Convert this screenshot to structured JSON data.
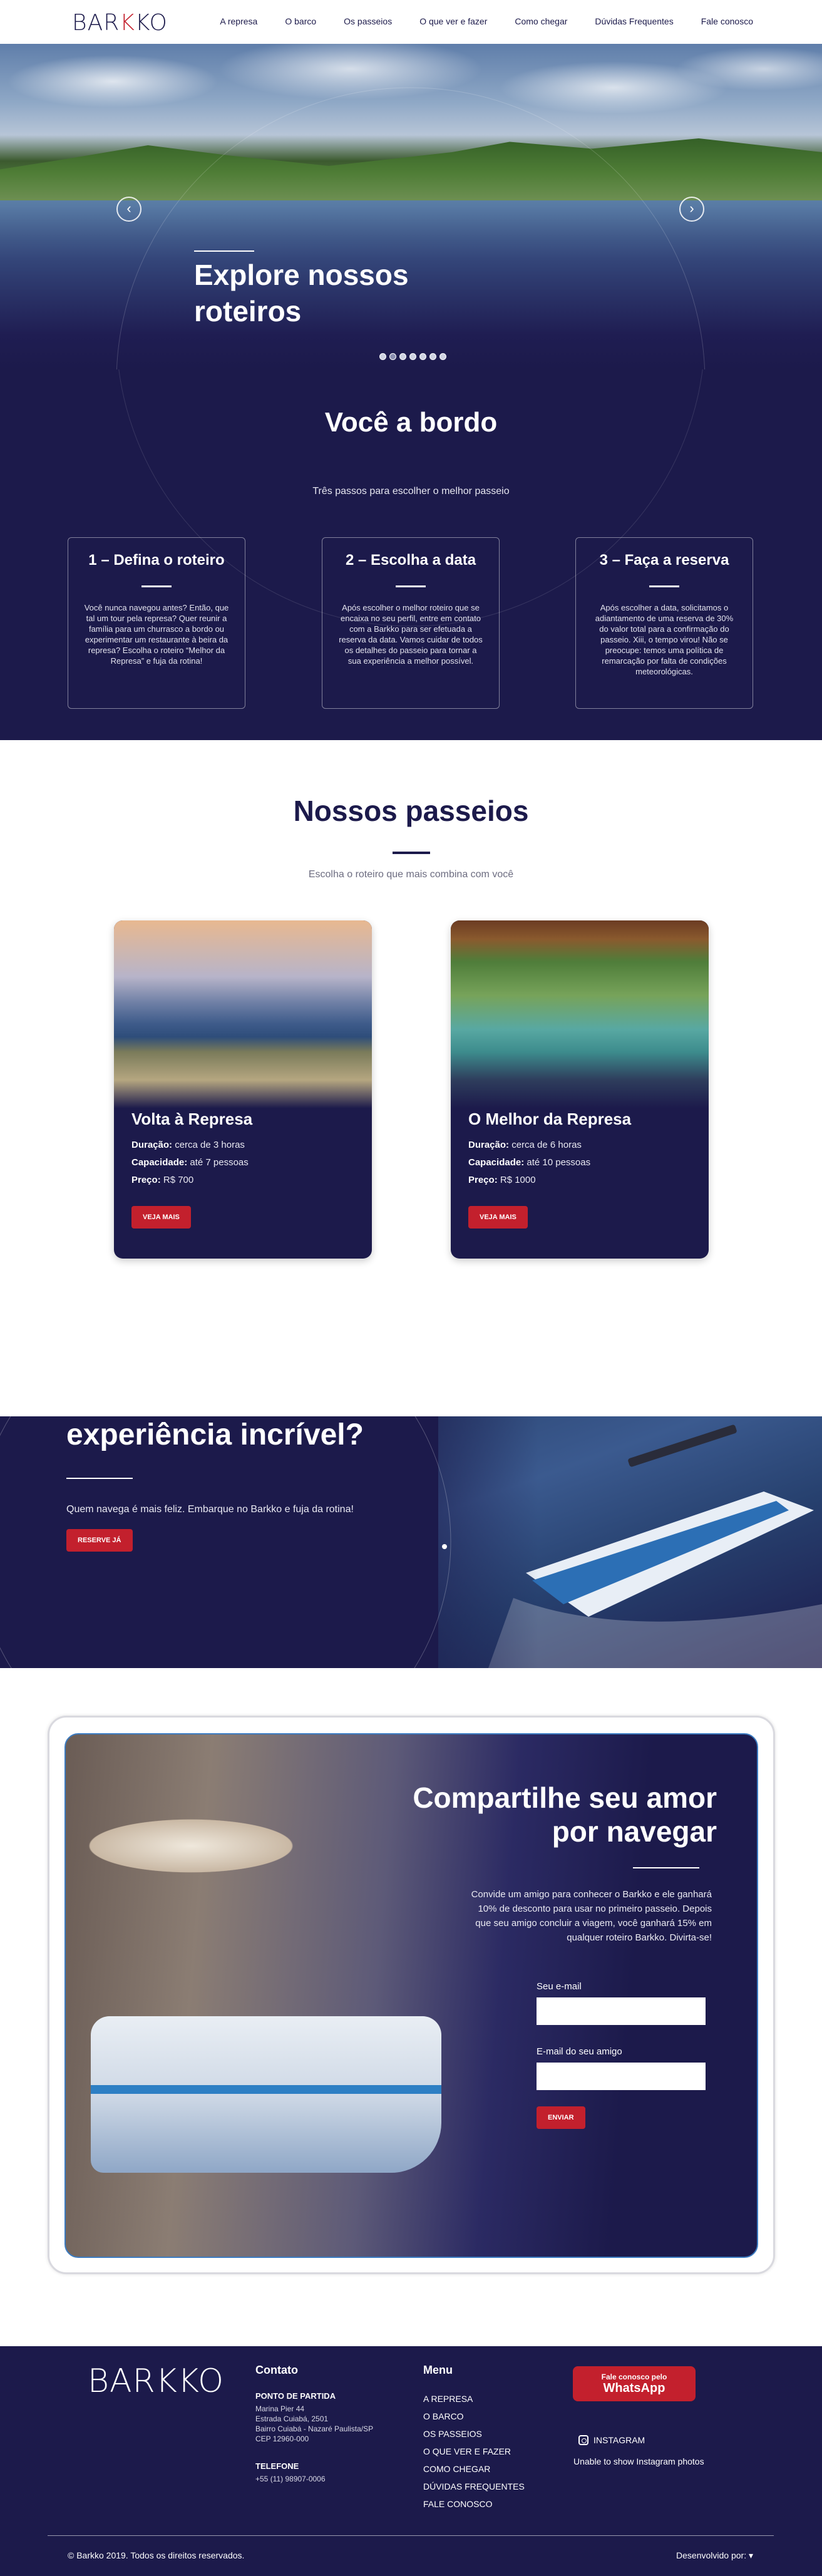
{
  "brand": {
    "logo": "BARKKO",
    "accent": "#c3202d",
    "primary": "#1c1a4b"
  },
  "nav": [
    "A represa",
    "O barco",
    "Os passeios",
    "O que ver e fazer",
    "Como chegar",
    "Dúvidas Frequentes",
    "Fale conosco"
  ],
  "hero": {
    "title_line1": "Explore nossos",
    "title_line2": "roteiros",
    "prev_icon": "chevron-left-icon",
    "next_icon": "chevron-right-icon",
    "slides": 7,
    "active_slide": 2
  },
  "steps": {
    "title": "Você a bordo",
    "subtitle": "Três passos para escolher o melhor passeio",
    "cards": [
      {
        "title": "1 – Defina o roteiro",
        "text": "Você nunca navegou antes? Então, que tal um tour pela represa? Quer reunir a família para um churrasco a bordo ou experimentar um restaurante à beira da represa? Escolha o roteiro “Melhor da Represa” e fuja da rotina!"
      },
      {
        "title": "2 – Escolha a data",
        "text": "Após escolher o melhor roteiro que se encaixa no seu perfil, entre em contato com a Barkko para ser efetuada a reserva da data. Vamos cuidar de todos os detalhes do passeio para tornar a sua experiência a melhor possível."
      },
      {
        "title": "3 – Faça a reserva",
        "text": "Após escolher a data, solicitamos o adiantamento de uma reserva de 30% do valor total para a confirmação do passeio. Xiii, o tempo virou! Não se preocupe: temos uma política de remarcação por falta de condições meteorológicas."
      }
    ]
  },
  "passeios": {
    "title": "Nossos passeios",
    "subtitle": "Escolha o roteiro que mais combina com você",
    "tours": [
      {
        "name": "Volta à Represa",
        "dur_label": "Duração:",
        "dur": "cerca de 3 horas",
        "cap_label": "Capacidade:",
        "cap": "até 7 pessoas",
        "price_label": "Preço:",
        "price": "R$ 700",
        "button": "VEJA MAIS"
      },
      {
        "name": "O Melhor da Represa",
        "dur_label": "Duração:",
        "dur": "cerca de 6 horas",
        "cap_label": "Capacidade:",
        "cap": "até 10 pessoas",
        "price_label": "Preço:",
        "price": "R$ 1000",
        "button": "VEJA MAIS"
      }
    ]
  },
  "promo": {
    "title": "experiência incrível?",
    "text": "Quem navega é mais feliz. Embarque no Barkko e fuja da rotina!",
    "button": "RESERVE JÁ"
  },
  "share": {
    "title_line1": "Compartilhe seu amor",
    "title_line2": "por navegar",
    "text": "Convide um amigo para conhecer o Barkko e ele ganhará 10% de desconto para usar no primeiro passeio. Depois que seu amigo concluir a viagem, você ganhará 15% em qualquer roteiro Barkko. Divirta-se!",
    "email_label": "Seu e-mail",
    "friend_label": "E-mail do seu amigo",
    "button": "ENVIAR"
  },
  "footer": {
    "logo": "BARKKO",
    "contact_title": "Contato",
    "departure_label": "PONTO DE PARTIDA",
    "address": [
      "Marina Pier 44",
      "Estrada Cuiabá, 2501",
      "Bairro Cuiabá - Nazaré Paulista/SP",
      "CEP 12960-000"
    ],
    "phone_label": "TELEFONE",
    "phone": "+55 (11) 98907-0006",
    "menu_title": "Menu",
    "menu": [
      "A REPRESA",
      "O BARCO",
      "OS PASSEIOS",
      "O QUE VER E FAZER",
      "COMO CHEGAR",
      "DÚVIDAS FREQUENTES",
      "FALE CONOSCO"
    ],
    "whatsapp_line1": "Fale conosco pelo",
    "whatsapp_line2": "WhatsApp",
    "instagram": "INSTAGRAM",
    "instagram_note": "Unable to show Instagram photos",
    "copyright": "© Barkko 2019. Todos os direitos reservados.",
    "dev_label": "Desenvolvido por:"
  }
}
